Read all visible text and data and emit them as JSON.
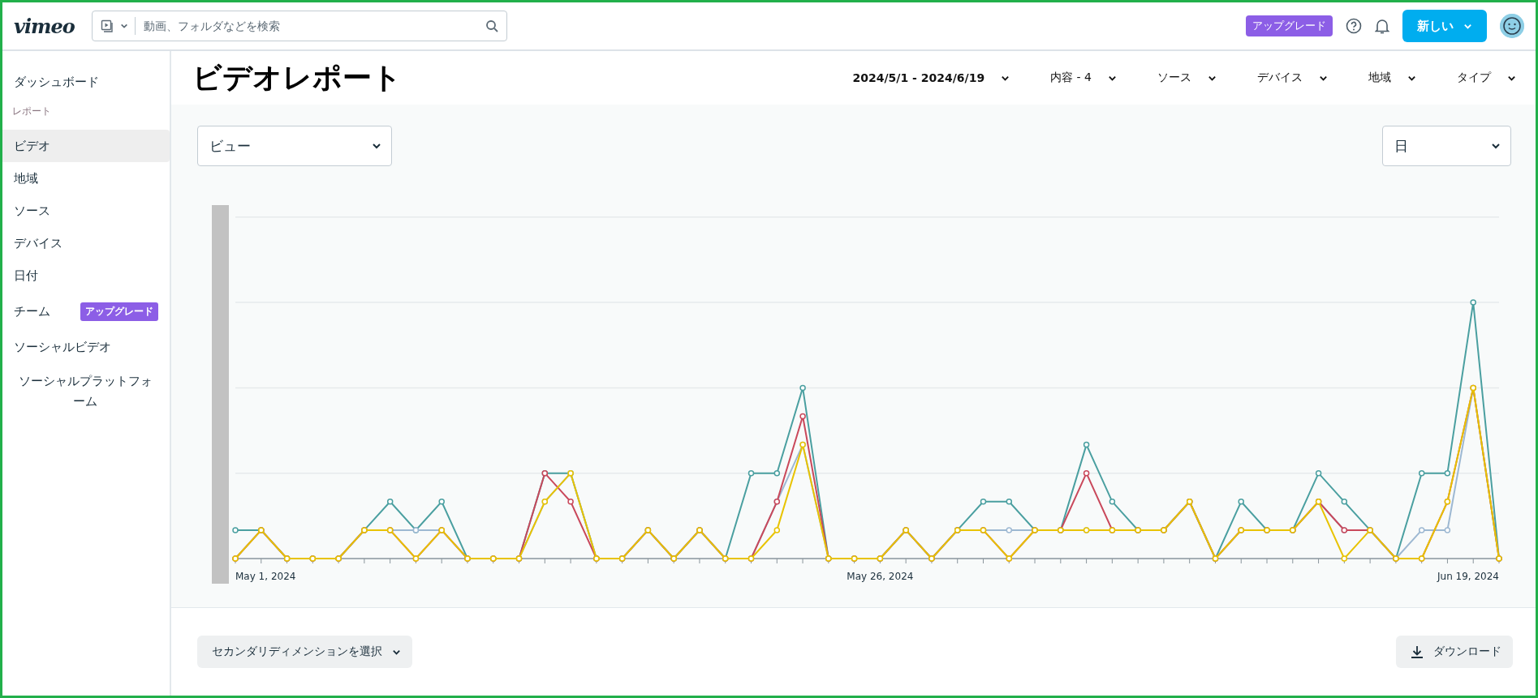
{
  "header": {
    "logo": "vimeo",
    "search": {
      "placeholder": "動画、フォルダなどを検索"
    },
    "upgrade_badge": "アップグレード",
    "new_button": "新しい"
  },
  "sidebar": {
    "top": "ダッシュボード",
    "section": "レポート",
    "items": [
      {
        "label": "ビデオ",
        "selected": true
      },
      {
        "label": "地域",
        "selected": false
      },
      {
        "label": "ソース",
        "selected": false
      },
      {
        "label": "デバイス",
        "selected": false
      },
      {
        "label": "日付",
        "selected": false
      },
      {
        "label": "チーム",
        "selected": false,
        "badge": "アップグレード"
      },
      {
        "label": "ソーシャルビデオ",
        "selected": false
      },
      {
        "label": "ソーシャルプラットフォーム",
        "selected": false
      }
    ]
  },
  "page": {
    "title": "ビデオレポート",
    "filters": [
      "2024/5/1 - 2024/6/19",
      "内容 - 4",
      "ソース",
      "デバイス",
      "地域",
      "タイプ"
    ]
  },
  "metric_select": {
    "value": "ビュー"
  },
  "interval_select": {
    "value": "日"
  },
  "chart": {
    "x_labels": [
      "May 1, 2024",
      "May 26, 2024",
      "Jun 19, 2024"
    ]
  },
  "footer": {
    "secondary_dimension": "セカンダリディメンションを選択",
    "download": "ダウンロード"
  }
}
